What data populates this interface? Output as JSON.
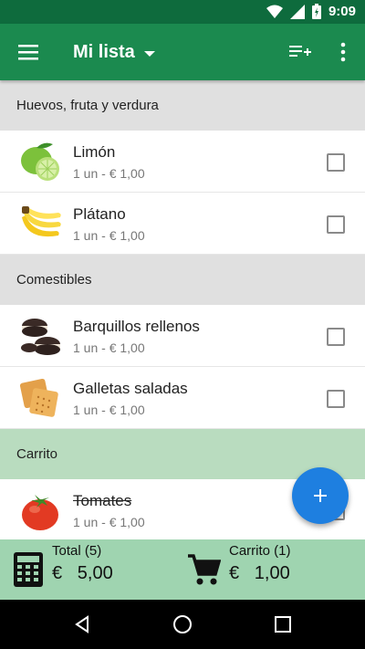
{
  "status_bar": {
    "time": "9:09"
  },
  "app_bar": {
    "title": "Mi lista"
  },
  "sections": [
    {
      "title": "Huevos, fruta y verdura",
      "items": [
        {
          "name": "Limón",
          "detail": "1 un - € 1,00",
          "icon": "lime-icon"
        },
        {
          "name": "Plátano",
          "detail": "1 un - € 1,00",
          "icon": "banana-icon"
        }
      ]
    },
    {
      "title": "Comestibles",
      "items": [
        {
          "name": "Barquillos rellenos",
          "detail": "1 un - € 1,00",
          "icon": "cookies-icon"
        },
        {
          "name": "Galletas saladas",
          "detail": "1 un - € 1,00",
          "icon": "crackers-icon"
        }
      ]
    },
    {
      "title": "Carrito",
      "items": [
        {
          "name": "Tomates",
          "detail": "1 un - € 1,00",
          "icon": "tomato-icon"
        }
      ]
    }
  ],
  "totals": {
    "total_label": "Total (5)",
    "total_amount": "€   5,00",
    "cart_label": "Carrito (1)",
    "cart_amount": "€   1,00"
  },
  "colors": {
    "primary_dark": "#0e6b3d",
    "primary": "#1b8a4f",
    "fab": "#1e7fe0",
    "cart_bg": "#b9dcbf",
    "bottom_bg": "#9fd4b0"
  }
}
